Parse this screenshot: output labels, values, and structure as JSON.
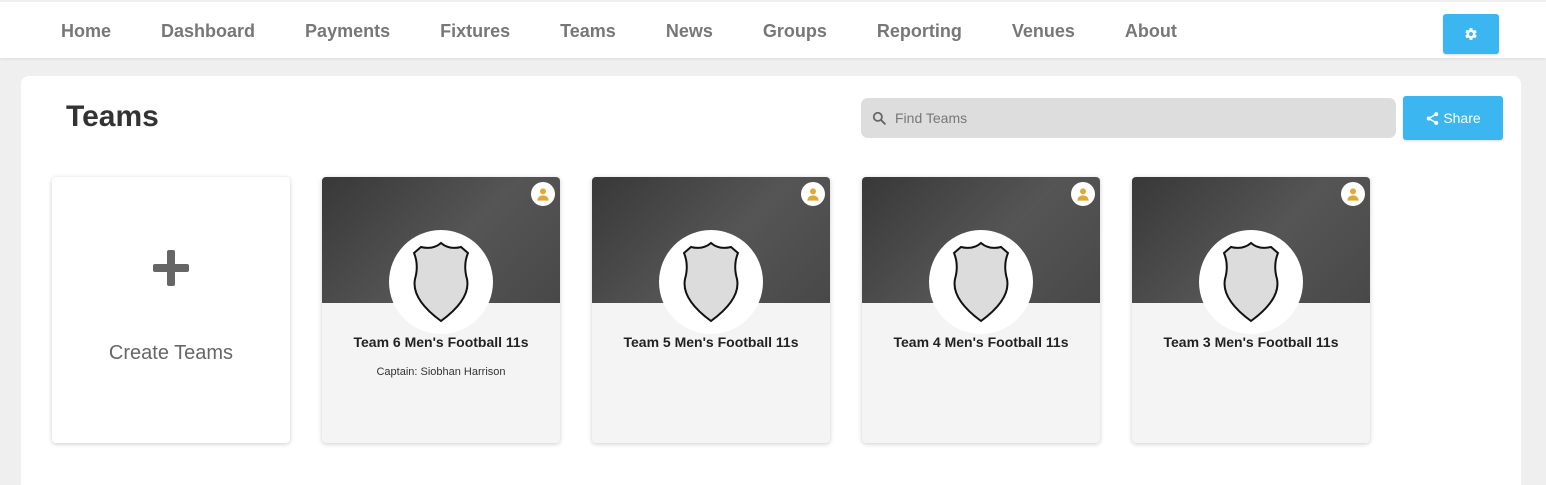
{
  "nav": {
    "items": [
      "Home",
      "Dashboard",
      "Payments",
      "Fixtures",
      "Teams",
      "News",
      "Groups",
      "Reporting",
      "Venues",
      "About"
    ]
  },
  "header": {
    "title": "Teams",
    "search_placeholder": "Find Teams",
    "search_value": "",
    "share_label": "Share"
  },
  "create_card": {
    "label": "Create Teams"
  },
  "teams": [
    {
      "name": "Team 6 Men's Football 11s",
      "captain": "Captain: Siobhan Harrison"
    },
    {
      "name": "Team 5 Men's Football 11s",
      "captain": ""
    },
    {
      "name": "Team 4 Men's Football 11s",
      "captain": ""
    },
    {
      "name": "Team 3 Men's Football 11s",
      "captain": ""
    }
  ],
  "icons": {
    "settings": "gear-icon",
    "search": "search-icon",
    "share": "share-icon",
    "create": "plus-icon",
    "captain": "person-icon",
    "crest": "shield-icon"
  },
  "colors": {
    "accent": "#3bb6f0",
    "captain_badge": "#e0a936",
    "banner": "#4a4a4a"
  }
}
